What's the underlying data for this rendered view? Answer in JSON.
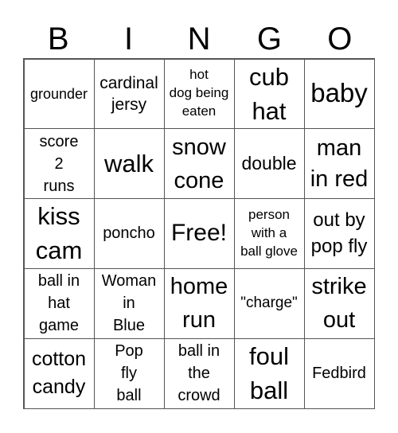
{
  "header": {
    "letters": [
      "B",
      "I",
      "N",
      "G",
      "O"
    ]
  },
  "grid": {
    "rows": [
      [
        "grounder",
        "cardinal\njersy",
        "hot\ndog being\neaten",
        "cub\nhat",
        "baby"
      ],
      [
        "score\n2\nruns",
        "walk",
        "snow\ncone",
        "double",
        "man\nin red"
      ],
      [
        "kiss\ncam",
        "poncho",
        "Free!",
        "person\nwith a\nball glove",
        "out by\npop fly"
      ],
      [
        "ball in\nhat\ngame",
        "Woman\nin\nBlue",
        "home\nrun",
        "\"charge\"",
        "strike\nout"
      ],
      [
        "cotton\ncandy",
        "Pop\nfly\nball",
        "ball in\nthe\ncrowd",
        "foul\nball",
        "Fedbird"
      ]
    ]
  }
}
